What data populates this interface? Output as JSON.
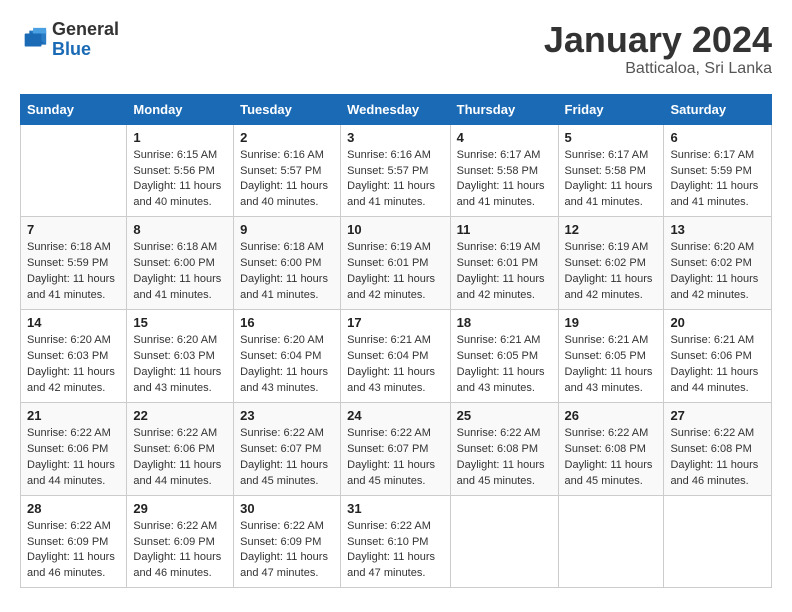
{
  "logo": {
    "general": "General",
    "blue": "Blue"
  },
  "title": "January 2024",
  "subtitle": "Batticaloa, Sri Lanka",
  "weekdays": [
    "Sunday",
    "Monday",
    "Tuesday",
    "Wednesday",
    "Thursday",
    "Friday",
    "Saturday"
  ],
  "weeks": [
    [
      {
        "day": "",
        "sunrise": "",
        "sunset": "",
        "daylight": ""
      },
      {
        "day": "1",
        "sunrise": "Sunrise: 6:15 AM",
        "sunset": "Sunset: 5:56 PM",
        "daylight": "Daylight: 11 hours and 40 minutes."
      },
      {
        "day": "2",
        "sunrise": "Sunrise: 6:16 AM",
        "sunset": "Sunset: 5:57 PM",
        "daylight": "Daylight: 11 hours and 40 minutes."
      },
      {
        "day": "3",
        "sunrise": "Sunrise: 6:16 AM",
        "sunset": "Sunset: 5:57 PM",
        "daylight": "Daylight: 11 hours and 41 minutes."
      },
      {
        "day": "4",
        "sunrise": "Sunrise: 6:17 AM",
        "sunset": "Sunset: 5:58 PM",
        "daylight": "Daylight: 11 hours and 41 minutes."
      },
      {
        "day": "5",
        "sunrise": "Sunrise: 6:17 AM",
        "sunset": "Sunset: 5:58 PM",
        "daylight": "Daylight: 11 hours and 41 minutes."
      },
      {
        "day": "6",
        "sunrise": "Sunrise: 6:17 AM",
        "sunset": "Sunset: 5:59 PM",
        "daylight": "Daylight: 11 hours and 41 minutes."
      }
    ],
    [
      {
        "day": "7",
        "sunrise": "Sunrise: 6:18 AM",
        "sunset": "Sunset: 5:59 PM",
        "daylight": "Daylight: 11 hours and 41 minutes."
      },
      {
        "day": "8",
        "sunrise": "Sunrise: 6:18 AM",
        "sunset": "Sunset: 6:00 PM",
        "daylight": "Daylight: 11 hours and 41 minutes."
      },
      {
        "day": "9",
        "sunrise": "Sunrise: 6:18 AM",
        "sunset": "Sunset: 6:00 PM",
        "daylight": "Daylight: 11 hours and 41 minutes."
      },
      {
        "day": "10",
        "sunrise": "Sunrise: 6:19 AM",
        "sunset": "Sunset: 6:01 PM",
        "daylight": "Daylight: 11 hours and 42 minutes."
      },
      {
        "day": "11",
        "sunrise": "Sunrise: 6:19 AM",
        "sunset": "Sunset: 6:01 PM",
        "daylight": "Daylight: 11 hours and 42 minutes."
      },
      {
        "day": "12",
        "sunrise": "Sunrise: 6:19 AM",
        "sunset": "Sunset: 6:02 PM",
        "daylight": "Daylight: 11 hours and 42 minutes."
      },
      {
        "day": "13",
        "sunrise": "Sunrise: 6:20 AM",
        "sunset": "Sunset: 6:02 PM",
        "daylight": "Daylight: 11 hours and 42 minutes."
      }
    ],
    [
      {
        "day": "14",
        "sunrise": "Sunrise: 6:20 AM",
        "sunset": "Sunset: 6:03 PM",
        "daylight": "Daylight: 11 hours and 42 minutes."
      },
      {
        "day": "15",
        "sunrise": "Sunrise: 6:20 AM",
        "sunset": "Sunset: 6:03 PM",
        "daylight": "Daylight: 11 hours and 43 minutes."
      },
      {
        "day": "16",
        "sunrise": "Sunrise: 6:20 AM",
        "sunset": "Sunset: 6:04 PM",
        "daylight": "Daylight: 11 hours and 43 minutes."
      },
      {
        "day": "17",
        "sunrise": "Sunrise: 6:21 AM",
        "sunset": "Sunset: 6:04 PM",
        "daylight": "Daylight: 11 hours and 43 minutes."
      },
      {
        "day": "18",
        "sunrise": "Sunrise: 6:21 AM",
        "sunset": "Sunset: 6:05 PM",
        "daylight": "Daylight: 11 hours and 43 minutes."
      },
      {
        "day": "19",
        "sunrise": "Sunrise: 6:21 AM",
        "sunset": "Sunset: 6:05 PM",
        "daylight": "Daylight: 11 hours and 43 minutes."
      },
      {
        "day": "20",
        "sunrise": "Sunrise: 6:21 AM",
        "sunset": "Sunset: 6:06 PM",
        "daylight": "Daylight: 11 hours and 44 minutes."
      }
    ],
    [
      {
        "day": "21",
        "sunrise": "Sunrise: 6:22 AM",
        "sunset": "Sunset: 6:06 PM",
        "daylight": "Daylight: 11 hours and 44 minutes."
      },
      {
        "day": "22",
        "sunrise": "Sunrise: 6:22 AM",
        "sunset": "Sunset: 6:06 PM",
        "daylight": "Daylight: 11 hours and 44 minutes."
      },
      {
        "day": "23",
        "sunrise": "Sunrise: 6:22 AM",
        "sunset": "Sunset: 6:07 PM",
        "daylight": "Daylight: 11 hours and 45 minutes."
      },
      {
        "day": "24",
        "sunrise": "Sunrise: 6:22 AM",
        "sunset": "Sunset: 6:07 PM",
        "daylight": "Daylight: 11 hours and 45 minutes."
      },
      {
        "day": "25",
        "sunrise": "Sunrise: 6:22 AM",
        "sunset": "Sunset: 6:08 PM",
        "daylight": "Daylight: 11 hours and 45 minutes."
      },
      {
        "day": "26",
        "sunrise": "Sunrise: 6:22 AM",
        "sunset": "Sunset: 6:08 PM",
        "daylight": "Daylight: 11 hours and 45 minutes."
      },
      {
        "day": "27",
        "sunrise": "Sunrise: 6:22 AM",
        "sunset": "Sunset: 6:08 PM",
        "daylight": "Daylight: 11 hours and 46 minutes."
      }
    ],
    [
      {
        "day": "28",
        "sunrise": "Sunrise: 6:22 AM",
        "sunset": "Sunset: 6:09 PM",
        "daylight": "Daylight: 11 hours and 46 minutes."
      },
      {
        "day": "29",
        "sunrise": "Sunrise: 6:22 AM",
        "sunset": "Sunset: 6:09 PM",
        "daylight": "Daylight: 11 hours and 46 minutes."
      },
      {
        "day": "30",
        "sunrise": "Sunrise: 6:22 AM",
        "sunset": "Sunset: 6:09 PM",
        "daylight": "Daylight: 11 hours and 47 minutes."
      },
      {
        "day": "31",
        "sunrise": "Sunrise: 6:22 AM",
        "sunset": "Sunset: 6:10 PM",
        "daylight": "Daylight: 11 hours and 47 minutes."
      },
      {
        "day": "",
        "sunrise": "",
        "sunset": "",
        "daylight": ""
      },
      {
        "day": "",
        "sunrise": "",
        "sunset": "",
        "daylight": ""
      },
      {
        "day": "",
        "sunrise": "",
        "sunset": "",
        "daylight": ""
      }
    ]
  ]
}
